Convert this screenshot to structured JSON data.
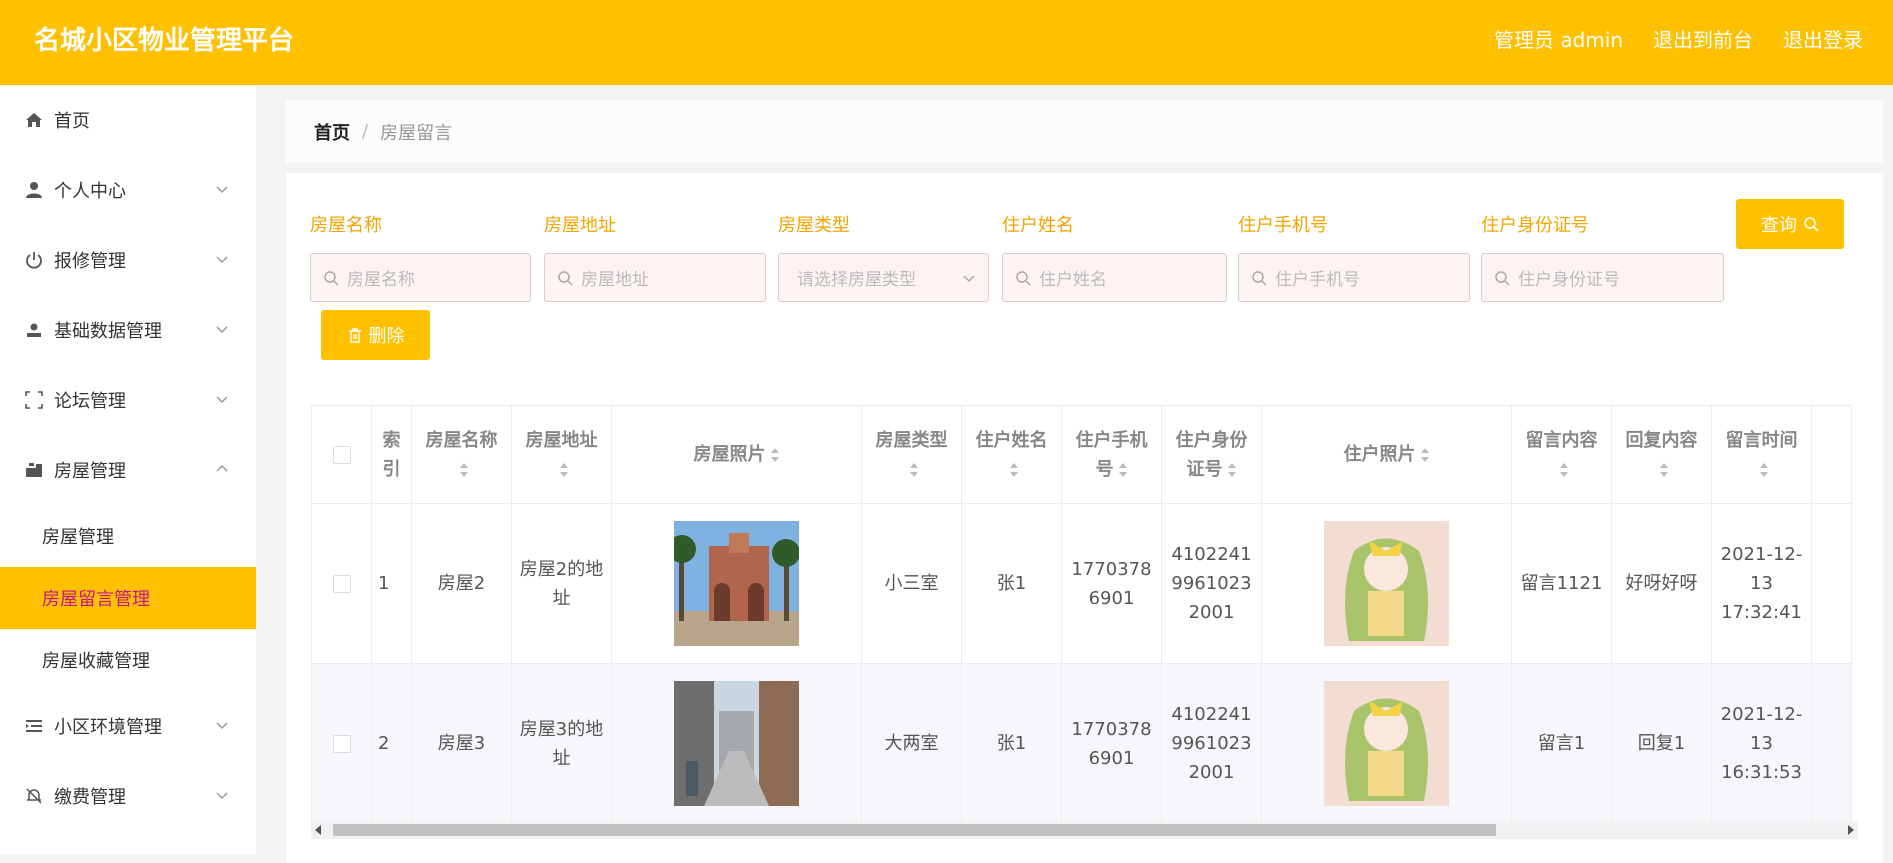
{
  "header": {
    "title": "名城小区物业管理平台",
    "admin_label": "管理员 admin",
    "to_front": "退出到前台",
    "logout": "退出登录"
  },
  "sidebar": {
    "items": [
      {
        "label": "首页",
        "icon": "home-icon"
      },
      {
        "label": "个人中心",
        "icon": "user-icon"
      },
      {
        "label": "报修管理",
        "icon": "power-icon"
      },
      {
        "label": "基础数据管理",
        "icon": "person-icon"
      },
      {
        "label": "论坛管理",
        "icon": "frame-icon"
      },
      {
        "label": "房屋管理",
        "icon": "house-icon"
      },
      {
        "label": "小区环境管理",
        "icon": "list-icon"
      },
      {
        "label": "缴费管理",
        "icon": "bell-off-icon"
      }
    ],
    "sub_items": [
      "房屋管理",
      "房屋留言管理",
      "房屋收藏管理"
    ],
    "active_sub": "房屋留言管理"
  },
  "breadcrumb": {
    "home": "首页",
    "sep": "/",
    "current": "房屋留言"
  },
  "filters": [
    {
      "label": "房屋名称",
      "placeholder": "房屋名称"
    },
    {
      "label": "房屋地址",
      "placeholder": "房屋地址"
    },
    {
      "label": "房屋类型",
      "placeholder": "请选择房屋类型"
    },
    {
      "label": "住户姓名",
      "placeholder": "住户姓名"
    },
    {
      "label": "住户手机号",
      "placeholder": "住户手机号"
    },
    {
      "label": "住户身份证号",
      "placeholder": "住户身份证号"
    }
  ],
  "buttons": {
    "search": "查询",
    "delete": "删除"
  },
  "table": {
    "headers": [
      "索引",
      "房屋名称",
      "房屋地址",
      "房屋照片",
      "房屋类型",
      "住户姓名",
      "住户手机号",
      "住户身份证号",
      "住户照片",
      "留言内容",
      "回复内容",
      "留言时间"
    ],
    "rows": [
      {
        "index": "1",
        "name": "房屋2",
        "address": "房屋2的地址",
        "type": "小三室",
        "resident": "张1",
        "phone": "17703786901",
        "id_card": "410224199610232001",
        "message": "留言1121",
        "reply": "好呀好呀",
        "time": "2021-12-13 17:32:41"
      },
      {
        "index": "2",
        "name": "房屋3",
        "address": "房屋3的地址",
        "type": "大两室",
        "resident": "张1",
        "phone": "17703786901",
        "id_card": "410224199610232001",
        "message": "留言1",
        "reply": "回复1",
        "time": "2021-12-13 16:31:53"
      }
    ]
  },
  "colors": {
    "accent": "#ffc000",
    "active_text": "#c71585",
    "label": "#f0a500"
  }
}
